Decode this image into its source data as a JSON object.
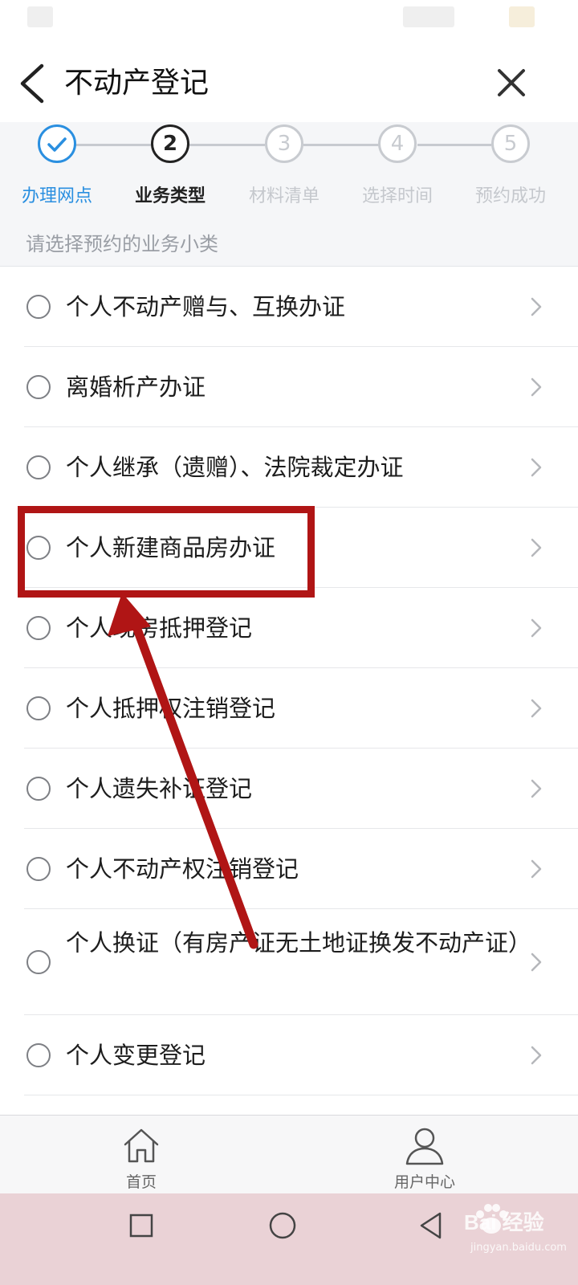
{
  "header": {
    "title": "不动产登记"
  },
  "steps": [
    {
      "number": "",
      "label": "办理网点",
      "state": "done"
    },
    {
      "number": "2",
      "label": "业务类型",
      "state": "active"
    },
    {
      "number": "3",
      "label": "材料清单",
      "state": "pending"
    },
    {
      "number": "4",
      "label": "选择时间",
      "state": "pending"
    },
    {
      "number": "5",
      "label": "预约成功",
      "state": "pending"
    }
  ],
  "subheader": "请选择预约的业务小类",
  "items": [
    {
      "label": "个人不动产赠与、互换办证"
    },
    {
      "label": "离婚析产办证"
    },
    {
      "label": "个人继承（遗赠）、法院裁定办证"
    },
    {
      "label": "个人新建商品房办证"
    },
    {
      "label": "个人现房抵押登记"
    },
    {
      "label": "个人抵押权注销登记"
    },
    {
      "label": "个人遗失补证登记"
    },
    {
      "label": "个人不动产权注销登记"
    },
    {
      "label": "个人换证（有房产证无土地证换发不动产证）"
    },
    {
      "label": "个人变更登记"
    }
  ],
  "tabbar": {
    "home": "首页",
    "user": "用户中心"
  },
  "watermark": {
    "brand": "Bai  经验",
    "site": "jingyan.baidu.com"
  },
  "colors": {
    "accent": "#2a8fe0",
    "annotation": "#b01515",
    "system_nav_bg": "#ead2d6"
  }
}
